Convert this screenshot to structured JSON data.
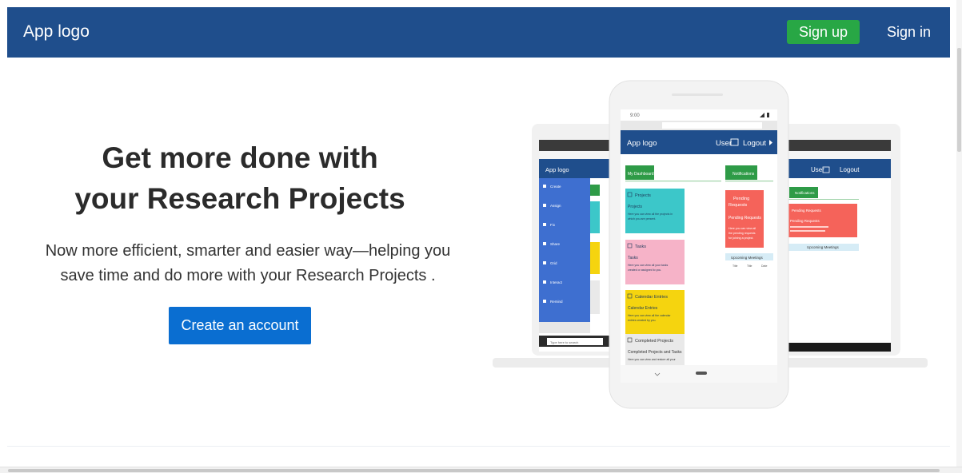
{
  "navbar": {
    "logo": "App logo",
    "signup_label": "Sign up",
    "signin_label": "Sign in"
  },
  "hero": {
    "title_line1": "Get more done with",
    "title_line2": "your Research Projects",
    "subtitle_line1": "Now more efficient, smarter and easier way—helping you",
    "subtitle_line2": "save time and do more with your Research Projects .",
    "cta_label": "Create an account"
  },
  "mockup": {
    "phone": {
      "status_time": "9:00",
      "app_logo": "App logo",
      "user_label": "User",
      "logout_label": "Logout",
      "dashboard_label": "My Dashboard",
      "notifications_label": "Notifications",
      "cards": [
        {
          "heading": "Projects",
          "title": "Projects",
          "desc1": "Here you can view all the projects in",
          "desc2": "which you are present.",
          "color": "#3cc7c9"
        },
        {
          "heading": "Tasks",
          "title": "Tasks",
          "desc1": "Here you can view all your tasks",
          "desc2": "created or assigned to you.",
          "color": "#f6b3c8"
        },
        {
          "heading": "Calendar Entries",
          "title": "Calendar Entries",
          "desc1": "Here you can view all the calendar",
          "desc2": "entries created by you.",
          "color": "#f5d40f"
        },
        {
          "heading": "Completed Projects",
          "title": "Completed Projects and Tasks",
          "desc1": "Here you can view and restore all your",
          "desc2": "",
          "color": "#e9e9e9"
        }
      ],
      "pending": {
        "heading1": "Pending",
        "heading2": "Requests",
        "title": "Pending Requests",
        "desc1": "Here you can view all",
        "desc2": "the pending requests",
        "desc3": "for joining a project."
      },
      "meetings": {
        "heading": "Upcoming Meetings",
        "cols": [
          "Title",
          "Title",
          "Date"
        ]
      }
    },
    "laptop_left": {
      "app_logo": "App logo",
      "menu": [
        "Create",
        "Assign",
        "Fix",
        "Share",
        "Grid",
        "Interact",
        "Remind"
      ],
      "search_placeholder": "Type here to search"
    },
    "laptop_right": {
      "user_label": "User",
      "logout_label": "Logout",
      "notifications_label": "Notifications",
      "pending_heading": "Pending Requests",
      "pending_title": "Pending Requests",
      "meetings_heading": "Upcoming Meetings"
    }
  },
  "colors": {
    "navbar": "#1f4e8c",
    "signup": "#28a745",
    "cta": "#0a6ed1",
    "green_accent": "#2e9b47",
    "red_card": "#f5635a"
  }
}
